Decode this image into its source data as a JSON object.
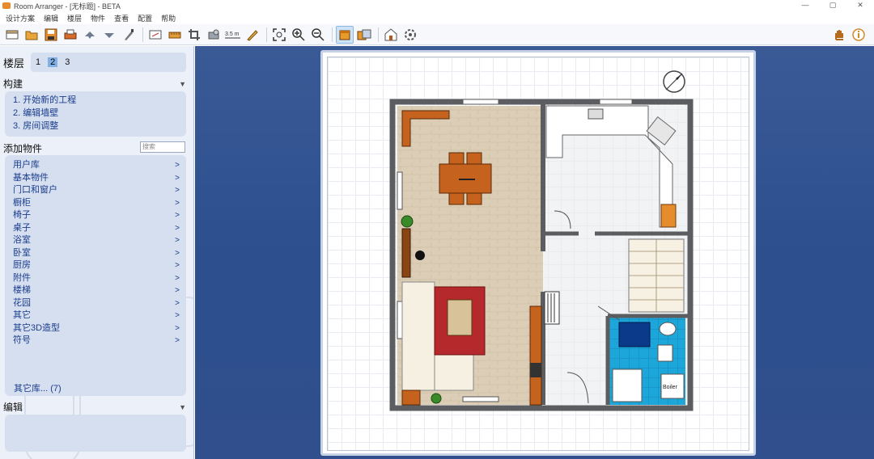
{
  "window": {
    "title": "Room Arranger - [无标题] - BETA",
    "controls": [
      "—",
      "▢",
      "✕"
    ]
  },
  "menu": [
    "设计方案",
    "编辑",
    "楼层",
    "物件",
    "查看",
    "配置",
    "帮助"
  ],
  "toolbar": {
    "tools": [
      {
        "name": "new-file-icon"
      },
      {
        "name": "open-folder-icon"
      },
      {
        "name": "save-icon"
      },
      {
        "name": "print-icon"
      },
      {
        "name": "undo-icon"
      },
      {
        "name": "redo-icon"
      },
      {
        "name": "paint-brush-icon"
      },
      {
        "name": "resize-project-icon"
      },
      {
        "name": "measure-icon"
      },
      {
        "name": "crop-icon"
      },
      {
        "name": "object-icon"
      },
      {
        "name": "dimension-icon"
      },
      {
        "name": "pencil-icon"
      },
      {
        "name": "zoom-fit-icon"
      },
      {
        "name": "zoom-in-icon"
      },
      {
        "name": "zoom-out-icon"
      },
      {
        "name": "view-2d-icon"
      },
      {
        "name": "view-3d-icon"
      },
      {
        "name": "house-3d-icon"
      },
      {
        "name": "settings-icon"
      }
    ],
    "dimension_label": "3.5 m",
    "right": [
      {
        "name": "hand-icon"
      },
      {
        "name": "info-icon"
      }
    ]
  },
  "sidebar": {
    "floors": {
      "label": "楼层",
      "numbers": [
        "1",
        "2",
        "3"
      ],
      "active": "2"
    },
    "build": {
      "label": "构建",
      "items": [
        "1. 开始新的工程",
        "2. 编辑墙壁",
        "3. 房间调整"
      ]
    },
    "add_objects": {
      "label": "添加物件",
      "search_placeholder": "搜索",
      "items": [
        "用户库",
        "基本物件",
        "门口和窗户",
        "橱柜",
        "椅子",
        "桌子",
        "浴室",
        "卧室",
        "厨房",
        "附件",
        "楼梯",
        "花园",
        "其它",
        "其它3D造型",
        "符号"
      ],
      "other_libraries": "其它库... (7)"
    },
    "edit": {
      "label": "编辑"
    }
  },
  "plan": {
    "boiler_label": "Boiler",
    "colors": {
      "wall": "#5b5d60",
      "wood_floor": "#dccdb7",
      "tile_floor": "#f2f3f5",
      "furniture_orange": "#c4621e",
      "bath_blue": "#1da6d9",
      "canvas_bg": "#2f4f8d"
    }
  }
}
